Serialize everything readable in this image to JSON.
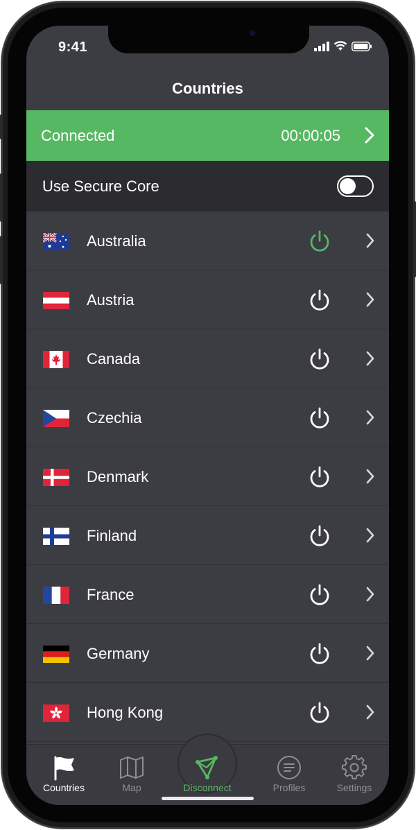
{
  "status_bar": {
    "time": "9:41"
  },
  "nav": {
    "title": "Countries"
  },
  "connection": {
    "status": "Connected",
    "timer": "00:00:05"
  },
  "secure_core": {
    "label": "Use Secure Core",
    "enabled": false
  },
  "countries": [
    {
      "name": "Australia",
      "connected": true
    },
    {
      "name": "Austria",
      "connected": false
    },
    {
      "name": "Canada",
      "connected": false
    },
    {
      "name": "Czechia",
      "connected": false
    },
    {
      "name": "Denmark",
      "connected": false
    },
    {
      "name": "Finland",
      "connected": false
    },
    {
      "name": "France",
      "connected": false
    },
    {
      "name": "Germany",
      "connected": false
    },
    {
      "name": "Hong Kong",
      "connected": false
    }
  ],
  "tabs": [
    {
      "label": "Countries",
      "icon": "flag-icon",
      "active": true
    },
    {
      "label": "Map",
      "icon": "map-icon",
      "active": false
    },
    {
      "label": "Disconnect",
      "icon": "vpn-triangle-icon",
      "active": false
    },
    {
      "label": "Profiles",
      "icon": "profiles-icon",
      "active": false
    },
    {
      "label": "Settings",
      "icon": "gear-icon",
      "active": false
    }
  ],
  "colors": {
    "accent": "#57b864",
    "background": "#3c3c43",
    "secure_row": "#2c2c30"
  }
}
